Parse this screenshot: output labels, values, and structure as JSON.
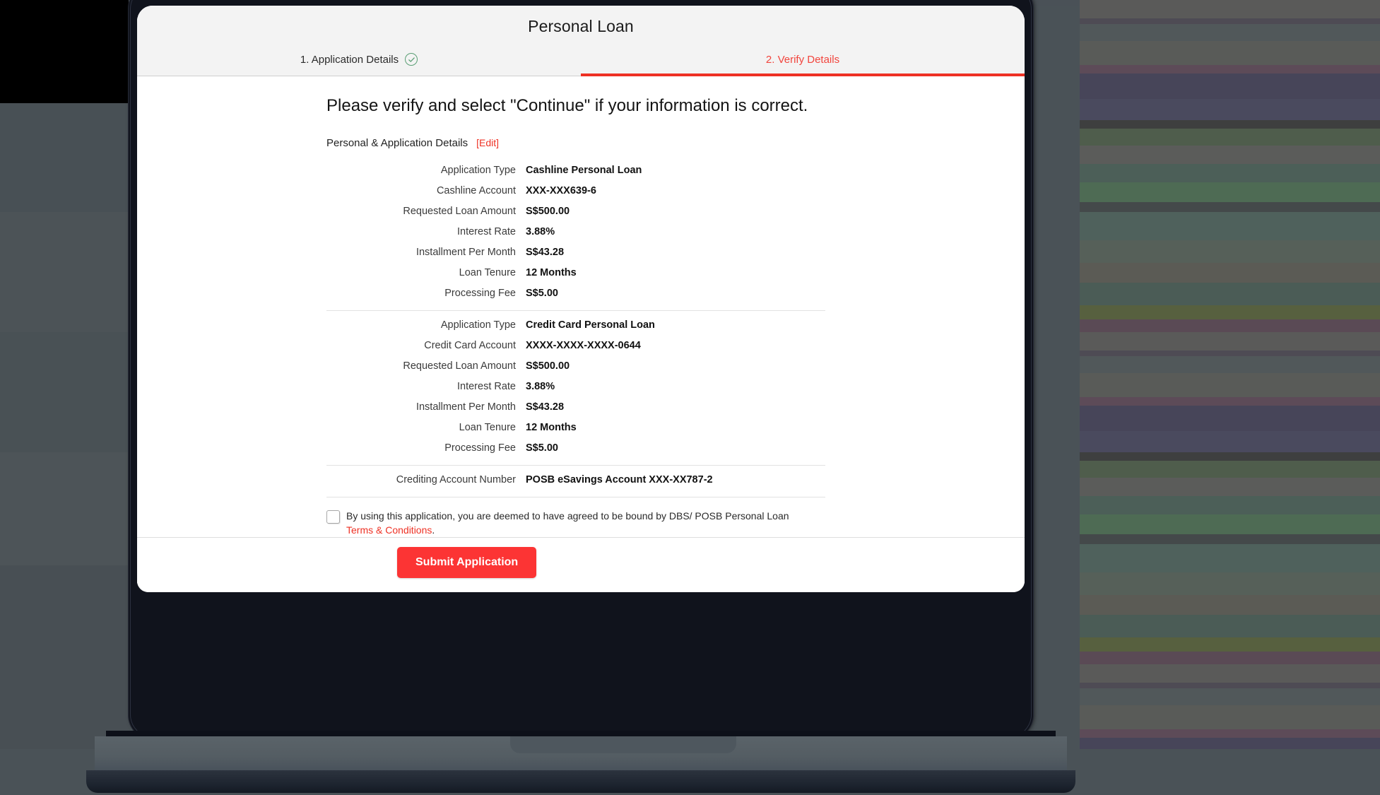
{
  "app": {
    "title": "Personal Loan",
    "steps": [
      {
        "label": "1. Application Details",
        "state": "completed",
        "icon": "check-circle-icon"
      },
      {
        "label": "2. Verify Details",
        "state": "active"
      }
    ],
    "headline": "Please verify and select \"Continue\" if your information is correct.",
    "section_title": "Personal & Application Details",
    "edit_label": "[Edit]",
    "sections": [
      {
        "rows": [
          {
            "label": "Application Type",
            "value": "Cashline Personal Loan"
          },
          {
            "label": "Cashline Account",
            "value": "XXX-XXX639-6"
          },
          {
            "label": "Requested Loan Amount",
            "value": "S$500.00"
          },
          {
            "label": "Interest Rate",
            "value": "3.88%"
          },
          {
            "label": "Installment Per Month",
            "value": "S$43.28"
          },
          {
            "label": "Loan Tenure",
            "value": "12 Months"
          },
          {
            "label": "Processing Fee",
            "value": "S$5.00"
          }
        ]
      },
      {
        "rows": [
          {
            "label": "Application Type",
            "value": "Credit Card Personal Loan"
          },
          {
            "label": "Credit Card Account",
            "value": "XXXX-XXXX-XXXX-0644"
          },
          {
            "label": "Requested Loan Amount",
            "value": "S$500.00"
          },
          {
            "label": "Interest Rate",
            "value": "3.88%"
          },
          {
            "label": "Installment Per Month",
            "value": "S$43.28"
          },
          {
            "label": "Loan Tenure",
            "value": "12 Months"
          },
          {
            "label": "Processing Fee",
            "value": "S$5.00"
          }
        ]
      },
      {
        "rows": [
          {
            "label": "Crediting Account Number",
            "value": "POSB eSavings Account XXX-XX787-2"
          }
        ]
      }
    ],
    "terms": {
      "checkbox_checked": false,
      "text_before": "By using this application, you are deemed to have agreed to be bound by DBS/ POSB Personal Loan ",
      "link_text": "Terms & Conditions",
      "text_after": "."
    },
    "submit_label": "Submit Application"
  },
  "colors": {
    "accent_red": "#ee3124",
    "button_red": "#fc3434",
    "check_green": "#5a9e74",
    "header_bg": "#f3f3f3"
  }
}
